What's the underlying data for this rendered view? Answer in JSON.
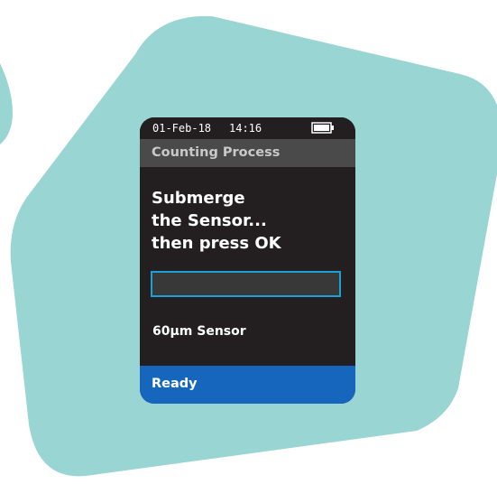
{
  "status_bar": {
    "date": "01-Feb-18",
    "time": "14:16",
    "battery_icon": "battery-icon"
  },
  "title_bar": {
    "title": "Counting Process"
  },
  "instruction": {
    "lines": [
      "Submerge",
      "the Sensor...",
      "then press OK"
    ]
  },
  "progress": {
    "value": 0
  },
  "sensor": {
    "label": "60µm Sensor"
  },
  "footer": {
    "status": "Ready"
  },
  "colors": {
    "backdrop": "#99d5d2",
    "screen": "#231f20",
    "title_bar": "#4b4a4a",
    "title_text": "#c9c9c9",
    "progress_border": "#18a3d4",
    "footer": "#1766bd"
  }
}
